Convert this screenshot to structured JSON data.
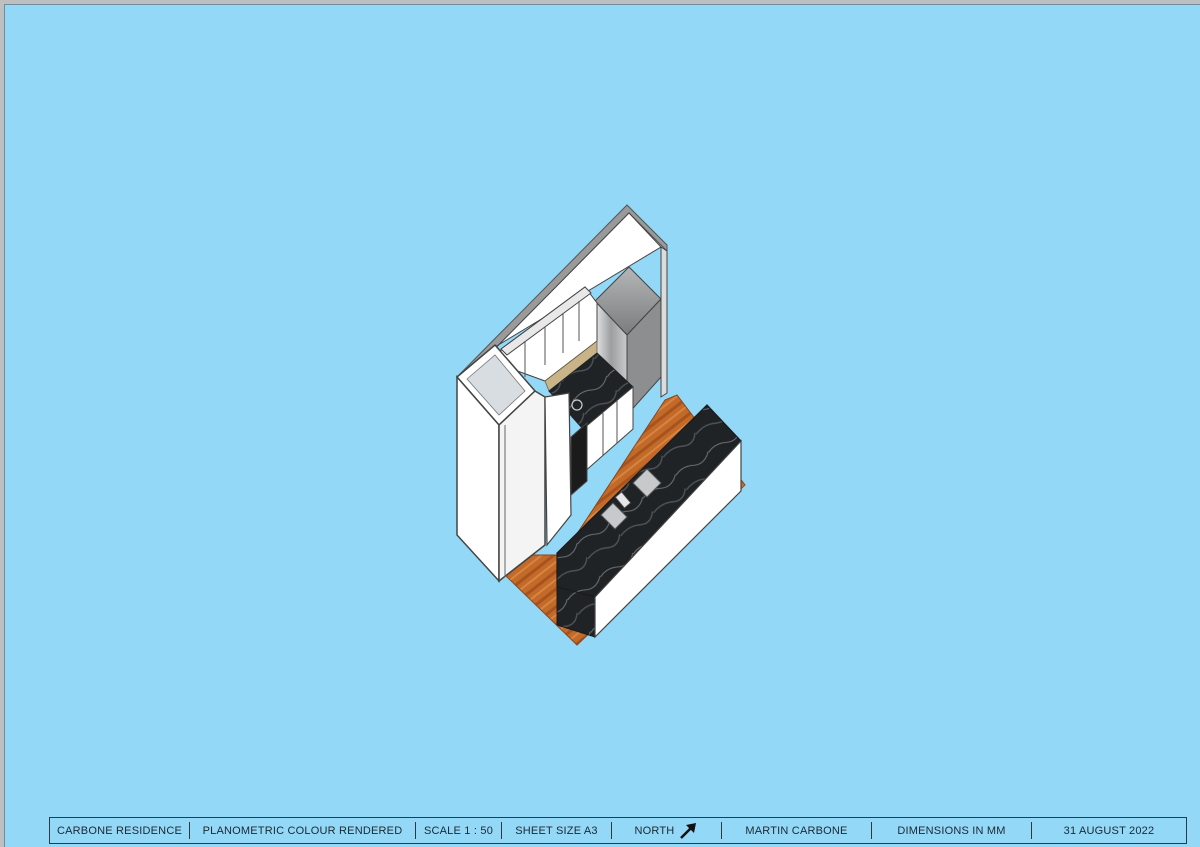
{
  "colors": {
    "sheet": "#93d8f7",
    "timber": "#c26a2a",
    "benchtop": "#1f2326",
    "cabinet": "#ffffff",
    "steel": "#a7a9ab",
    "outline": "#3a3a3a"
  },
  "title_block": {
    "project": "CARBONE RESIDENCE",
    "drawing_type": "PLANOMETRIC COLOUR RENDERED",
    "scale": "SCALE 1 : 50",
    "sheet_size": "SHEET SIZE A3",
    "north": "NORTH",
    "north_icon": "north-arrow-icon",
    "designer": "MARTIN CARBONE",
    "dimensions": "DIMENSIONS IN MM",
    "date": "31 AUGUST 2022"
  }
}
